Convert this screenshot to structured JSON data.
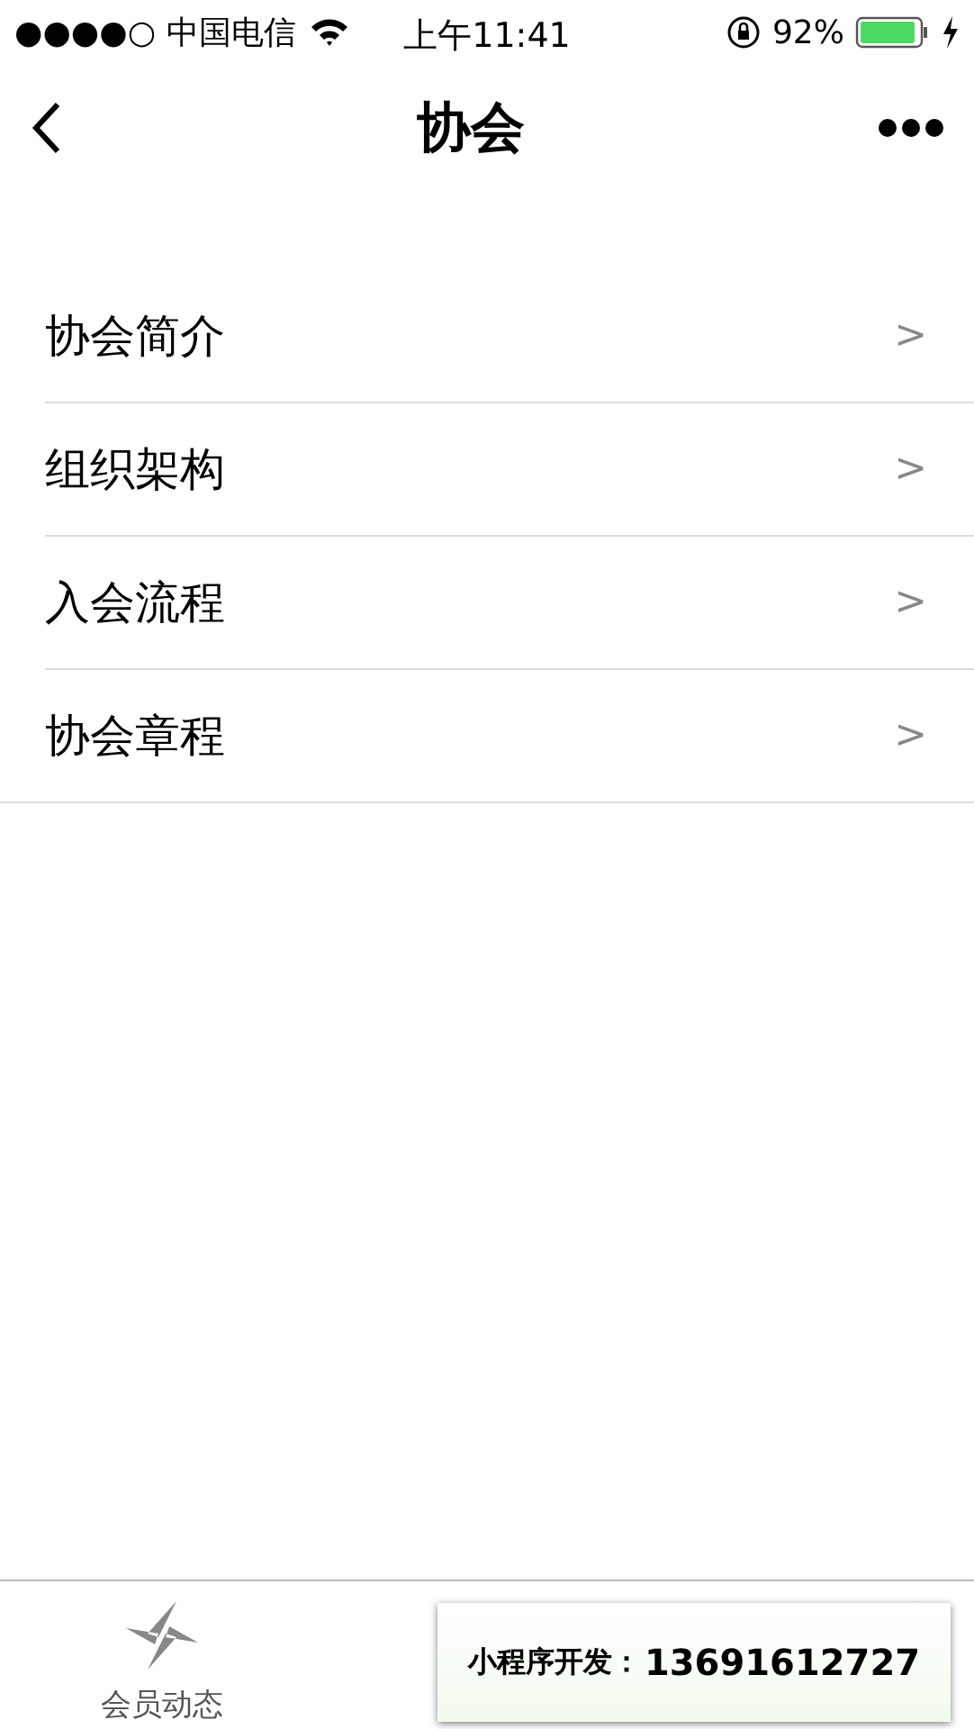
{
  "status_bar": {
    "carrier": "●●●●○ 中国电信",
    "time": "上午11:41",
    "battery": "92%"
  },
  "nav_bar": {
    "title": "协会"
  },
  "menu": [
    {
      "label": "协会简介",
      "chevron": ">"
    },
    {
      "label": "组织架构",
      "chevron": ">"
    },
    {
      "label": "入会流程",
      "chevron": ">"
    },
    {
      "label": "协会章程",
      "chevron": ">"
    }
  ],
  "tab_bar": [
    {
      "label": "会员动态",
      "selected": false
    }
  ],
  "popup": {
    "label": "小程序开发：",
    "phone": "13691612727"
  }
}
